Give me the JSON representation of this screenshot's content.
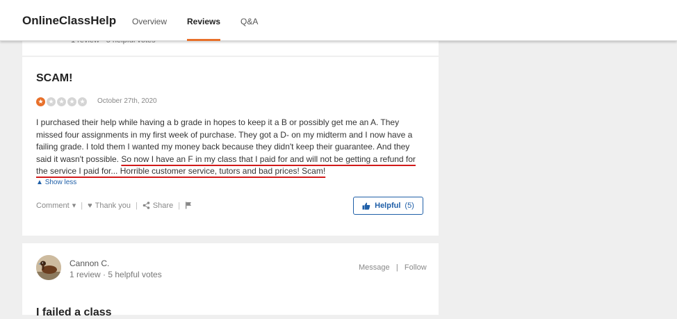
{
  "header": {
    "brand": "OnlineClassHelp",
    "tabs": [
      {
        "label": "Overview",
        "active": false
      },
      {
        "label": "Reviews",
        "active": true
      },
      {
        "label": "Q&A",
        "active": false
      }
    ],
    "accent_color": "#e8702a"
  },
  "previous_review": {
    "meta": "1 review  ·  5 helpful votes"
  },
  "review": {
    "title": "SCAM!",
    "rating": 1,
    "rating_max": 5,
    "date": "October 27th, 2020",
    "text_plain": "I purchased their help while having a b grade in hopes to keep it a B or possibly get me an A. They missed four assignments in my first week of purchase. They got a D- on my midterm and I now have a failing grade. I told them I wanted my money back because they didn't keep their guarantee. And they said it wasn't possible. ",
    "text_highlighted": "So now I have an F in my class that I paid for and will not be getting a refund for the service I paid for... Horrible customer service, tutors and bad prices! Scam!",
    "highlight_color": "#d11a1a",
    "show_less": "Show less",
    "actions": {
      "comment": "Comment",
      "thank_you": "Thank you",
      "share": "Share"
    },
    "helpful_label": "Helpful",
    "helpful_count": "(5)"
  },
  "next_review": {
    "reviewer_name": "Cannon C.",
    "reviewer_meta": "1 review  ·  5 helpful votes",
    "message_label": "Message",
    "follow_label": "Follow",
    "title": "I failed a class"
  },
  "colors": {
    "link_blue": "#1f5fa8",
    "background": "#efefef"
  }
}
